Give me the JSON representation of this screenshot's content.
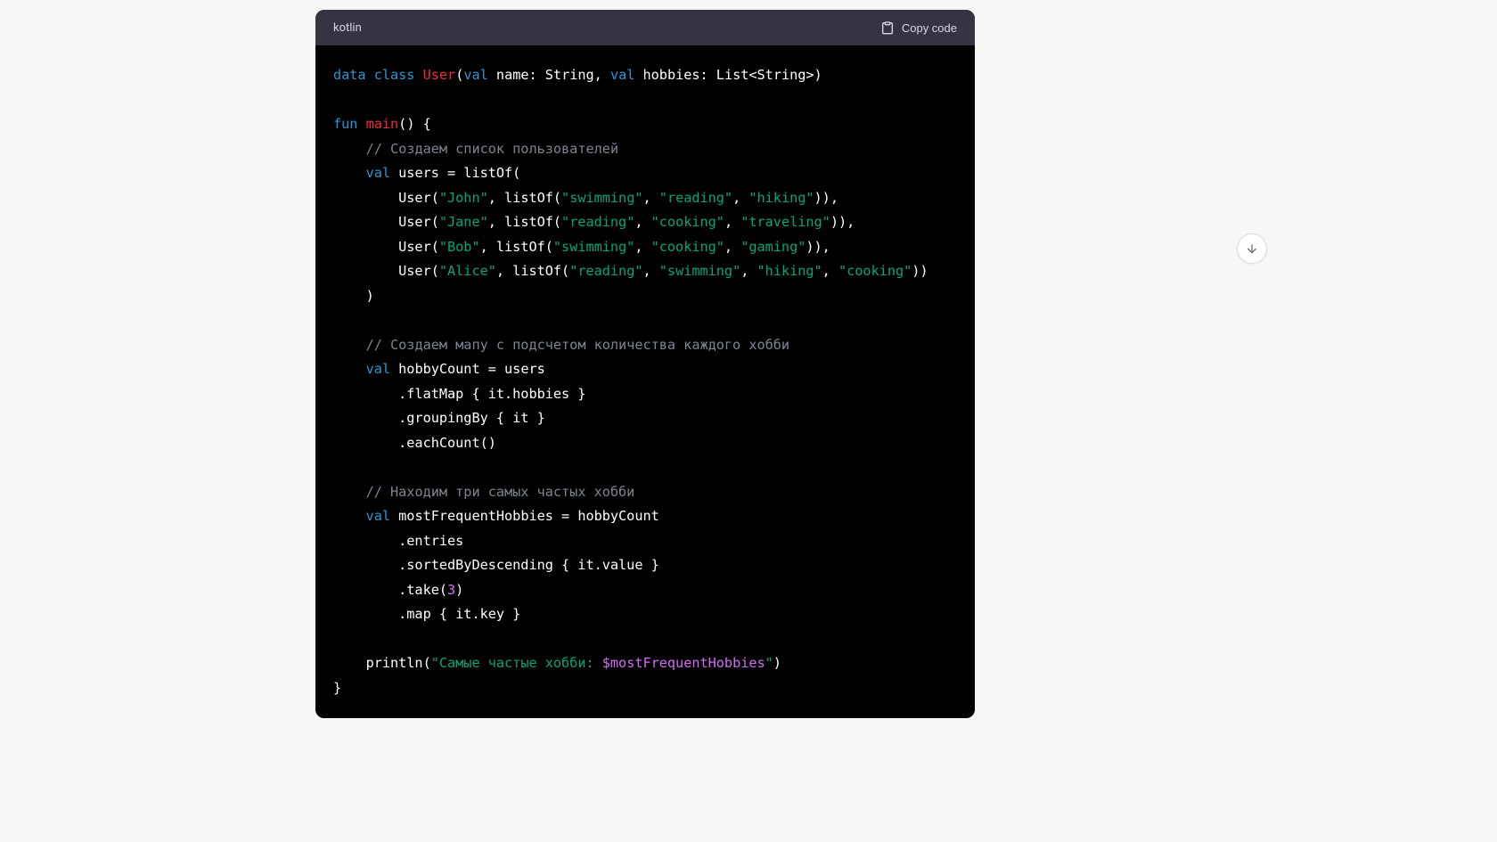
{
  "header": {
    "language": "kotlin",
    "copy_label": "Copy code"
  },
  "code": {
    "tokens": [
      {
        "t": "kw",
        "v": "data"
      },
      {
        "t": "",
        "v": " "
      },
      {
        "t": "kw",
        "v": "class"
      },
      {
        "t": "",
        "v": " "
      },
      {
        "t": "cls",
        "v": "User"
      },
      {
        "t": "",
        "v": "("
      },
      {
        "t": "kw",
        "v": "val"
      },
      {
        "t": "",
        "v": " name: String, "
      },
      {
        "t": "kw",
        "v": "val"
      },
      {
        "t": "",
        "v": " hobbies: List<String>)"
      },
      {
        "t": "nl"
      },
      {
        "t": "nl"
      },
      {
        "t": "kw",
        "v": "fun"
      },
      {
        "t": "",
        "v": " "
      },
      {
        "t": "func",
        "v": "main"
      },
      {
        "t": "",
        "v": "() {"
      },
      {
        "t": "nl"
      },
      {
        "t": "",
        "v": "    "
      },
      {
        "t": "com",
        "v": "// Создаем список пользователей"
      },
      {
        "t": "nl"
      },
      {
        "t": "",
        "v": "    "
      },
      {
        "t": "kw",
        "v": "val"
      },
      {
        "t": "",
        "v": " users = listOf("
      },
      {
        "t": "nl"
      },
      {
        "t": "",
        "v": "        User("
      },
      {
        "t": "str",
        "v": "\"John\""
      },
      {
        "t": "",
        "v": ", listOf("
      },
      {
        "t": "str",
        "v": "\"swimming\""
      },
      {
        "t": "",
        "v": ", "
      },
      {
        "t": "str",
        "v": "\"reading\""
      },
      {
        "t": "",
        "v": ", "
      },
      {
        "t": "str",
        "v": "\"hiking\""
      },
      {
        "t": "",
        "v": ")),"
      },
      {
        "t": "nl"
      },
      {
        "t": "",
        "v": "        User("
      },
      {
        "t": "str",
        "v": "\"Jane\""
      },
      {
        "t": "",
        "v": ", listOf("
      },
      {
        "t": "str",
        "v": "\"reading\""
      },
      {
        "t": "",
        "v": ", "
      },
      {
        "t": "str",
        "v": "\"cooking\""
      },
      {
        "t": "",
        "v": ", "
      },
      {
        "t": "str",
        "v": "\"traveling\""
      },
      {
        "t": "",
        "v": ")),"
      },
      {
        "t": "nl"
      },
      {
        "t": "",
        "v": "        User("
      },
      {
        "t": "str",
        "v": "\"Bob\""
      },
      {
        "t": "",
        "v": ", listOf("
      },
      {
        "t": "str",
        "v": "\"swimming\""
      },
      {
        "t": "",
        "v": ", "
      },
      {
        "t": "str",
        "v": "\"cooking\""
      },
      {
        "t": "",
        "v": ", "
      },
      {
        "t": "str",
        "v": "\"gaming\""
      },
      {
        "t": "",
        "v": ")),"
      },
      {
        "t": "nl"
      },
      {
        "t": "",
        "v": "        User("
      },
      {
        "t": "str",
        "v": "\"Alice\""
      },
      {
        "t": "",
        "v": ", listOf("
      },
      {
        "t": "str",
        "v": "\"reading\""
      },
      {
        "t": "",
        "v": ", "
      },
      {
        "t": "str",
        "v": "\"swimming\""
      },
      {
        "t": "",
        "v": ", "
      },
      {
        "t": "str",
        "v": "\"hiking\""
      },
      {
        "t": "",
        "v": ", "
      },
      {
        "t": "str",
        "v": "\"cooking\""
      },
      {
        "t": "",
        "v": "))"
      },
      {
        "t": "nl"
      },
      {
        "t": "",
        "v": "    )"
      },
      {
        "t": "nl"
      },
      {
        "t": "nl"
      },
      {
        "t": "",
        "v": "    "
      },
      {
        "t": "com",
        "v": "// Создаем мапу с подсчетом количества каждого хобби"
      },
      {
        "t": "nl"
      },
      {
        "t": "",
        "v": "    "
      },
      {
        "t": "kw",
        "v": "val"
      },
      {
        "t": "",
        "v": " hobbyCount = users"
      },
      {
        "t": "nl"
      },
      {
        "t": "",
        "v": "        .flatMap { it.hobbies }"
      },
      {
        "t": "nl"
      },
      {
        "t": "",
        "v": "        .groupingBy { it }"
      },
      {
        "t": "nl"
      },
      {
        "t": "",
        "v": "        .eachCount()"
      },
      {
        "t": "nl"
      },
      {
        "t": "nl"
      },
      {
        "t": "",
        "v": "    "
      },
      {
        "t": "com",
        "v": "// Находим три самых частых хобби"
      },
      {
        "t": "nl"
      },
      {
        "t": "",
        "v": "    "
      },
      {
        "t": "kw",
        "v": "val"
      },
      {
        "t": "",
        "v": " mostFrequentHobbies = hobbyCount"
      },
      {
        "t": "nl"
      },
      {
        "t": "",
        "v": "        .entries"
      },
      {
        "t": "nl"
      },
      {
        "t": "",
        "v": "        .sortedByDescending { it.value }"
      },
      {
        "t": "nl"
      },
      {
        "t": "",
        "v": "        .take("
      },
      {
        "t": "num",
        "v": "3"
      },
      {
        "t": "",
        "v": ")"
      },
      {
        "t": "nl"
      },
      {
        "t": "",
        "v": "        .map { it.key }"
      },
      {
        "t": "nl"
      },
      {
        "t": "nl"
      },
      {
        "t": "",
        "v": "    println("
      },
      {
        "t": "str",
        "v": "\"Самые частые хобби: "
      },
      {
        "t": "interp",
        "v": "$mostFrequentHobbies"
      },
      {
        "t": "str",
        "v": "\""
      },
      {
        "t": "",
        "v": ")"
      },
      {
        "t": "nl"
      },
      {
        "t": "",
        "v": "}"
      }
    ]
  }
}
